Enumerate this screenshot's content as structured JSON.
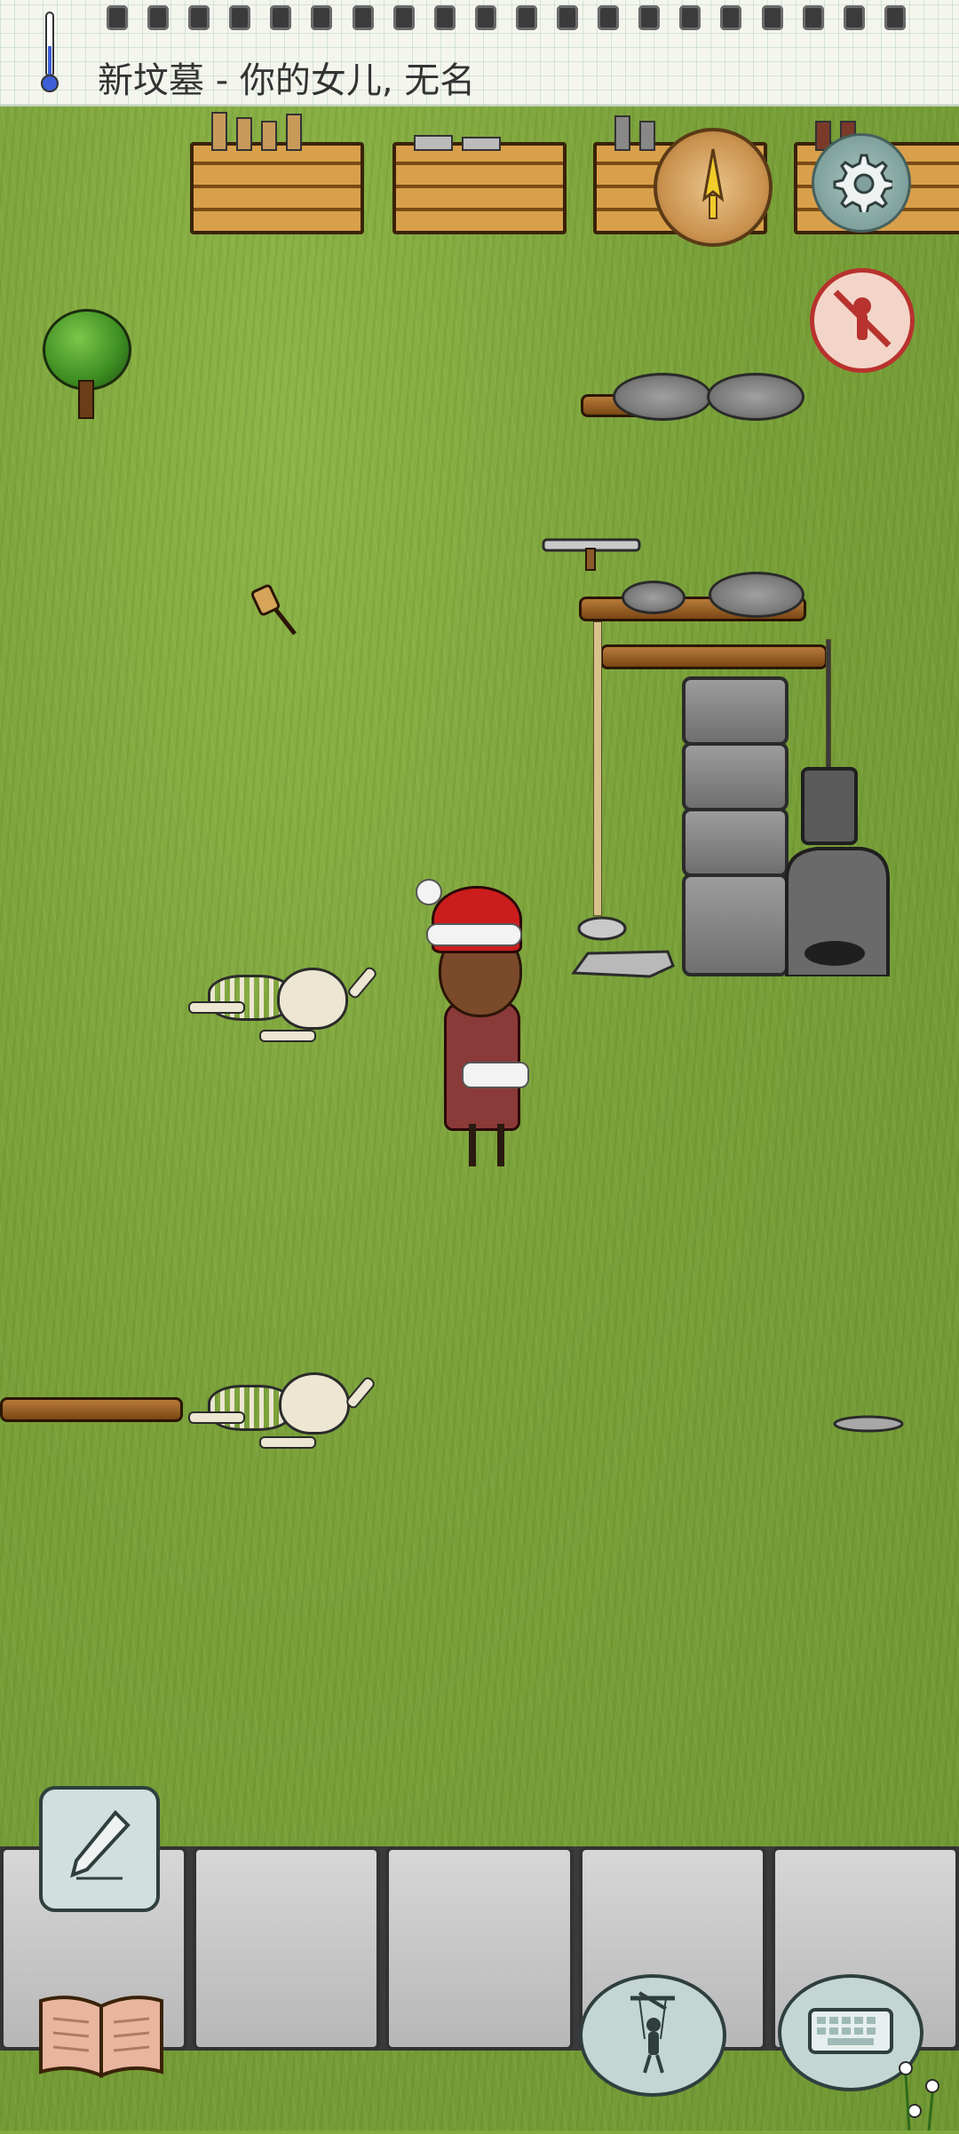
{
  "header": {
    "title": "新坟墓 - 你的女儿, 无名",
    "spiral_rings": 20
  },
  "icons": {
    "temperature": "thermometer-icon",
    "compass": "compass-icon",
    "settings": "gear-icon",
    "no_player": "no-player-icon",
    "notes": "pencil-icon",
    "tech": "book-icon",
    "emote": "puppet-icon",
    "chat": "keyboard-icon"
  },
  "colors": {
    "grass": "#7fa83c",
    "accent_red": "#b8322e",
    "hat_red": "#cc1d1d"
  }
}
